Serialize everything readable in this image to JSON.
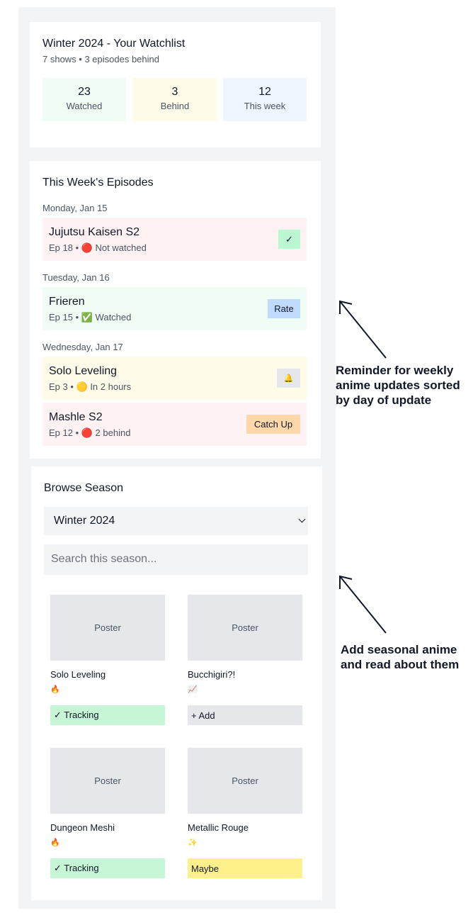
{
  "summary": {
    "title": "Winter 2024 - Your Watchlist",
    "subtitle": "7 shows • 3 episodes behind",
    "stats": [
      {
        "value": "23",
        "label": "Watched",
        "color": "#f0fdf4"
      },
      {
        "value": "3",
        "label": "Behind",
        "color": "#fefce8"
      },
      {
        "value": "12",
        "label": "This week",
        "color": "#eff6ff"
      }
    ]
  },
  "week": {
    "title": "This Week's Episodes",
    "days": [
      {
        "label": "Monday, Jan 15"
      },
      {
        "label": "Tuesday, Jan 16"
      },
      {
        "label": "Wednesday, Jan 17"
      }
    ],
    "episodes": [
      {
        "name": "Jujutsu Kaisen S2",
        "meta": "Ep 18 • 🔴 Not watched",
        "action": "✓",
        "bg": "#fef2f2",
        "action_bg": "#bbf7d0"
      },
      {
        "name": "Frieren",
        "meta": "Ep 15 • ✅ Watched",
        "action": "Rate",
        "bg": "#f0fdf4",
        "action_bg": "#bfdbfe"
      },
      {
        "name": "Solo Leveling",
        "meta": "Ep 3 • 🟡 In 2 hours",
        "action": "🔔",
        "bg": "#fefce8",
        "action_bg": "#e5e7eb"
      },
      {
        "name": "Mashle S2",
        "meta": "Ep 12 • 🔴 2 behind",
        "action": "Catch Up",
        "bg": "#fef2f2",
        "action_bg": "#fed7aa"
      }
    ]
  },
  "browse": {
    "title": "Browse Season",
    "season_selected": "Winter 2024",
    "search_placeholder": "Search this season...",
    "poster_label": "Poster",
    "shows": [
      {
        "name": "Solo Leveling",
        "emoji": "🔥",
        "button": "✓ Tracking",
        "button_bg": "#c6f6d5"
      },
      {
        "name": "Bucchigiri?!",
        "emoji": "📈",
        "button": "+ Add",
        "button_bg": "#e5e7eb"
      },
      {
        "name": "Dungeon Meshi",
        "emoji": "🔥",
        "button": "✓ Tracking",
        "button_bg": "#c6f6d5"
      },
      {
        "name": "Metallic Rouge",
        "emoji": "✨",
        "button": "Maybe",
        "button_bg": "#fef08a"
      }
    ]
  },
  "annotations": [
    {
      "text": "Reminder for weekly anime updates sorted by day of update"
    },
    {
      "text": "Add seasonal anime and read about them"
    }
  ]
}
